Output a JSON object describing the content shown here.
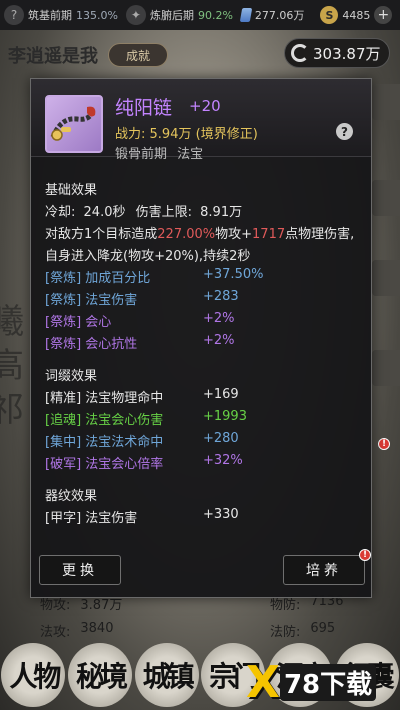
{
  "status_bar": {
    "realm1": "筑基前期",
    "realm1_pct": "135.0%",
    "realm2": "炼腑后期",
    "realm2_pct": "90.2%",
    "spirit_stones": "277.06万",
    "coins": "4485"
  },
  "header": {
    "player_name": "李逍遥是我",
    "achievement_label": "成就",
    "total_power": "303.87万"
  },
  "item": {
    "name": "纯阳链",
    "enhance": "+20",
    "power_label": "战力:",
    "power_value": "5.94万",
    "power_note": "(境界修正)",
    "realm": "锻骨前期",
    "category": "法宝",
    "help": "?"
  },
  "basic": {
    "title": "基础效果",
    "cooldown_label": "冷却:",
    "cooldown_value": "24.0秒",
    "cap_label": "伤害上限:",
    "cap_value": "8.91万",
    "desc_1a": "对敌方1个目标造成",
    "desc_1b": "227.00%",
    "desc_1c": "物攻+",
    "desc_1d": "1717",
    "desc_1e": "点物理伤害,",
    "desc_2": "自身进入降龙(物攻+20%),持续2秒",
    "refines": [
      {
        "tag": "[祭炼]",
        "name": "加成百分比",
        "value": "+37.50%"
      },
      {
        "tag": "[祭炼]",
        "name": "法宝伤害",
        "value": "+283"
      },
      {
        "tag": "[祭炼]",
        "name": "会心",
        "value": "+2%"
      },
      {
        "tag": "[祭炼]",
        "name": "会心抗性",
        "value": "+2%"
      }
    ]
  },
  "affix": {
    "title": "词缀效果",
    "rows": [
      {
        "tag": "[精准]",
        "name": "法宝物理命中",
        "value": "+169"
      },
      {
        "tag": "[追魂]",
        "name": "法宝会心伤害",
        "value": "+1993"
      },
      {
        "tag": "[集中]",
        "name": "法宝法术命中",
        "value": "+280"
      },
      {
        "tag": "[破军]",
        "name": "法宝会心倍率",
        "value": "+32%"
      }
    ]
  },
  "pattern": {
    "title": "器纹效果",
    "rows": [
      {
        "tag": "[甲字]",
        "name": "法宝伤害",
        "value": "+330"
      }
    ]
  },
  "buttons": {
    "replace": "更换",
    "cultivate": "培养"
  },
  "background_stats": {
    "phys_atk_label": "物攻:",
    "phys_atk": "3.87万",
    "phys_def_label": "物防:",
    "phys_def": "7136",
    "mag_atk_label": "法攻:",
    "mag_atk": "3840",
    "mag_def_label": "法防:",
    "mag_def": "695"
  },
  "bottom_nav": [
    "人物",
    "秘境",
    "城镇",
    "宗门",
    "洞府",
    "行囊"
  ],
  "watermark": "78下载",
  "colors": {
    "item_name": "#c384ff",
    "power": "#e4c45c",
    "refine_tag": "#6fa6d8",
    "refine_value": "#b076e6",
    "affix_green": "#67d146"
  }
}
